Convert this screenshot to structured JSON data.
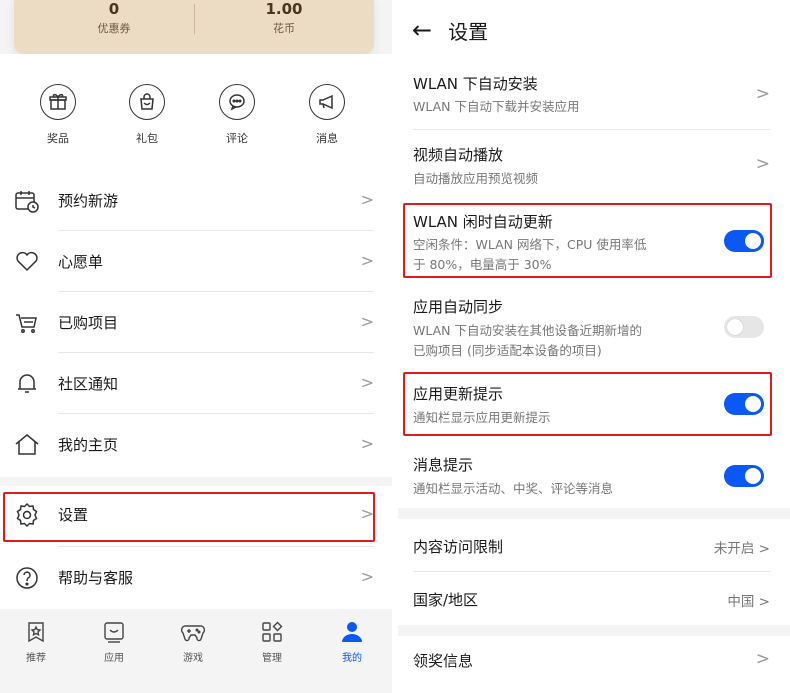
{
  "left": {
    "coupons": {
      "count": "0",
      "count_label": "优惠券",
      "coins": "1.00",
      "coins_label": "花币"
    },
    "quick_actions": [
      {
        "label": "奖品",
        "icon": "gift-icon"
      },
      {
        "label": "礼包",
        "icon": "package-icon"
      },
      {
        "label": "评论",
        "icon": "comment-icon"
      },
      {
        "label": "消息",
        "icon": "megaphone-icon"
      }
    ],
    "menu": [
      {
        "label": "预约新游",
        "icon": "calendar-icon"
      },
      {
        "label": "心愿单",
        "icon": "heart-icon"
      },
      {
        "label": "已购项目",
        "icon": "cart-icon"
      },
      {
        "label": "社区通知",
        "icon": "bell-icon"
      },
      {
        "label": "我的主页",
        "icon": "home-icon"
      },
      {
        "label": "设置",
        "icon": "gear-icon"
      },
      {
        "label": "帮助与客服",
        "icon": "help-icon"
      }
    ],
    "chevron": ">",
    "bottom_nav": [
      {
        "label": "推荐",
        "icon": "recommend-icon"
      },
      {
        "label": "应用",
        "icon": "apps-icon"
      },
      {
        "label": "游戏",
        "icon": "gamepad-icon"
      },
      {
        "label": "管理",
        "icon": "manage-icon"
      },
      {
        "label": "我的",
        "icon": "profile-icon"
      }
    ],
    "active_nav": "我的"
  },
  "right": {
    "back_icon": "←",
    "title": "设置",
    "settings": [
      {
        "title": "WLAN 下自动安装",
        "desc": "WLAN 下自动下载并安装应用",
        "control": "chevron"
      },
      {
        "title": "视频自动播放",
        "desc": "自动播放应用预览视频",
        "control": "chevron"
      },
      {
        "title": "WLAN 闲时自动更新",
        "desc1": "空闲条件：WLAN 网络下，CPU 使用率低",
        "desc2": "于 80%，电量高于 30%",
        "control": "toggle",
        "on": true
      },
      {
        "title": "应用自动同步",
        "desc1": "WLAN 下自动安装在其他设备近期新增的",
        "desc2": "已购项目 (同步适配本设备的项目)",
        "control": "toggle",
        "on": false
      },
      {
        "title": "应用更新提示",
        "desc": "通知栏显示应用更新提示",
        "control": "toggle",
        "on": true
      },
      {
        "title": "消息提示",
        "desc": "通知栏显示活动、中奖、评论等消息",
        "control": "toggle",
        "on": true
      }
    ],
    "content_restriction": {
      "label": "内容访问限制",
      "value": "未开启 >"
    },
    "region": {
      "label": "国家/地区",
      "value": "中国 >"
    },
    "prize_info": {
      "label": "领奖信息",
      "chevron": ">"
    }
  },
  "colors": {
    "accent": "#0a59f7",
    "highlight": "#e3191b",
    "card": "#ecdcc4"
  }
}
